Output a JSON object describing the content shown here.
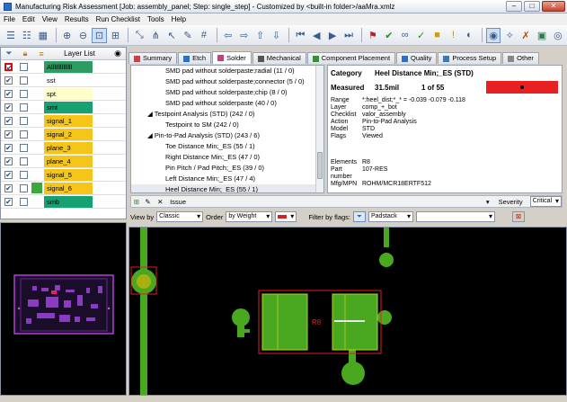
{
  "window": {
    "title": "Manufacturing Risk Assessment [Job: assembly_panel; Step: single_step] - Customized by <built-in folder>/aaMra.xmlz"
  },
  "menu": [
    "File",
    "Edit",
    "View",
    "Results",
    "Run Checklist",
    "Tools",
    "Help"
  ],
  "layer_list": {
    "title": "Layer List",
    "layers": [
      {
        "name": "Allllllllllllll",
        "color": "#2e9c62",
        "sw": "#ffffff",
        "checked": true
      },
      {
        "name": "sst",
        "color": "#ffffff",
        "sw": "#ffffff",
        "checked": true
      },
      {
        "name": "spt",
        "color": "#ffffcc",
        "sw": "#ffffff",
        "checked": true
      },
      {
        "name": "smt",
        "color": "#17a070",
        "sw": "#ffffff",
        "checked": true
      },
      {
        "name": "signal_1",
        "color": "#f5c518",
        "sw": "#ffffff",
        "checked": true
      },
      {
        "name": "signal_2",
        "color": "#f5c518",
        "sw": "#ffffff",
        "checked": true
      },
      {
        "name": "plane_3",
        "color": "#f5c518",
        "sw": "#ffffff",
        "checked": true
      },
      {
        "name": "plane_4",
        "color": "#f5c518",
        "sw": "#ffffff",
        "checked": true
      },
      {
        "name": "signal_5",
        "color": "#f5c518",
        "sw": "#ffffff",
        "checked": true
      },
      {
        "name": "signal_6",
        "color": "#f5c518",
        "sw": "#3aa83a",
        "checked": true
      },
      {
        "name": "smb",
        "color": "#17a070",
        "sw": "#ffffff",
        "checked": true
      }
    ]
  },
  "tabs": [
    {
      "label": "Summary",
      "color": "#d04040"
    },
    {
      "label": "Etch",
      "color": "#3070c0"
    },
    {
      "label": "Solder",
      "color": "#c04080",
      "active": true
    },
    {
      "label": "Mechanical",
      "color": "#555"
    },
    {
      "label": "Component Placement",
      "color": "#3a8c3a"
    },
    {
      "label": "Quality",
      "color": "#2a70c8"
    },
    {
      "label": "Process Setup",
      "color": "#3a7ab8"
    },
    {
      "label": "Other",
      "color": "#888"
    }
  ],
  "checklist": [
    {
      "text": "SMD pad without solderpaste;radial (11 / 0)",
      "indent": 38
    },
    {
      "text": "SMD pad without solderpaste;connector (5 / 0)",
      "indent": 38
    },
    {
      "text": "SMD pad without solderpaste;chip (8 / 0)",
      "indent": 38
    },
    {
      "text": "SMD pad without solderpaste (40 / 0)",
      "indent": 38
    },
    {
      "text": "◢ Testpoint Analysis (STD) (242 / 0)",
      "indent": 18
    },
    {
      "text": "Testpoint to SM (242 / 0)",
      "indent": 38
    },
    {
      "text": "◢ Pin-to-Pad Analysis (STD) (243 / 6)",
      "indent": 18
    },
    {
      "text": "Toe Distance Min;_ES (55 / 1)",
      "indent": 38
    },
    {
      "text": "Right Distance Min;_ES (47 / 0)",
      "indent": 38
    },
    {
      "text": "Pin Pitch / Pad Pitch;_ES (39 / 0)",
      "indent": 38
    },
    {
      "text": "Left Distance Min;_ES (47 / 4)",
      "indent": 38
    },
    {
      "text": "Heel Distance Min;_ES (55 / 1)",
      "indent": 38,
      "selected": true
    }
  ],
  "detail": {
    "category_label": "Category",
    "category_value": "Heel Distance Min;_ES  (STD)",
    "measured_label": "Measured",
    "measured_value": "31.5mil",
    "count": "1 of 55",
    "measure_color": "#e82020",
    "fields": [
      {
        "label": "Range",
        "value": "*:heel_dist;*_* = -0.039 -0.079 -0.118"
      },
      {
        "label": "Layer",
        "value": "comp_+_bot"
      },
      {
        "label": "Checklist",
        "value": "valor_assembly"
      },
      {
        "label": "Action",
        "value": "Pin-to-Pad Analysis"
      },
      {
        "label": "Model",
        "value": "STD"
      },
      {
        "label": "Flags",
        "value": "Viewed"
      }
    ],
    "fields2": [
      {
        "label": "Elements",
        "value": "R8"
      },
      {
        "label": "Part number",
        "value": "107-RES"
      },
      {
        "label": "Mfg/MPN",
        "value": "ROHM/MCR18ERTF512"
      }
    ]
  },
  "issue": {
    "label": "Issue",
    "severity_label": "Severity",
    "severity_value": "Critical"
  },
  "filter": {
    "view_by_label": "View by",
    "view_by_value": "Classic",
    "order_label": "Order",
    "order_value": "by Weight",
    "flags_label": "Filter by flags:",
    "padstack_value": "Padstack"
  },
  "board": {
    "refdes": "R8"
  }
}
